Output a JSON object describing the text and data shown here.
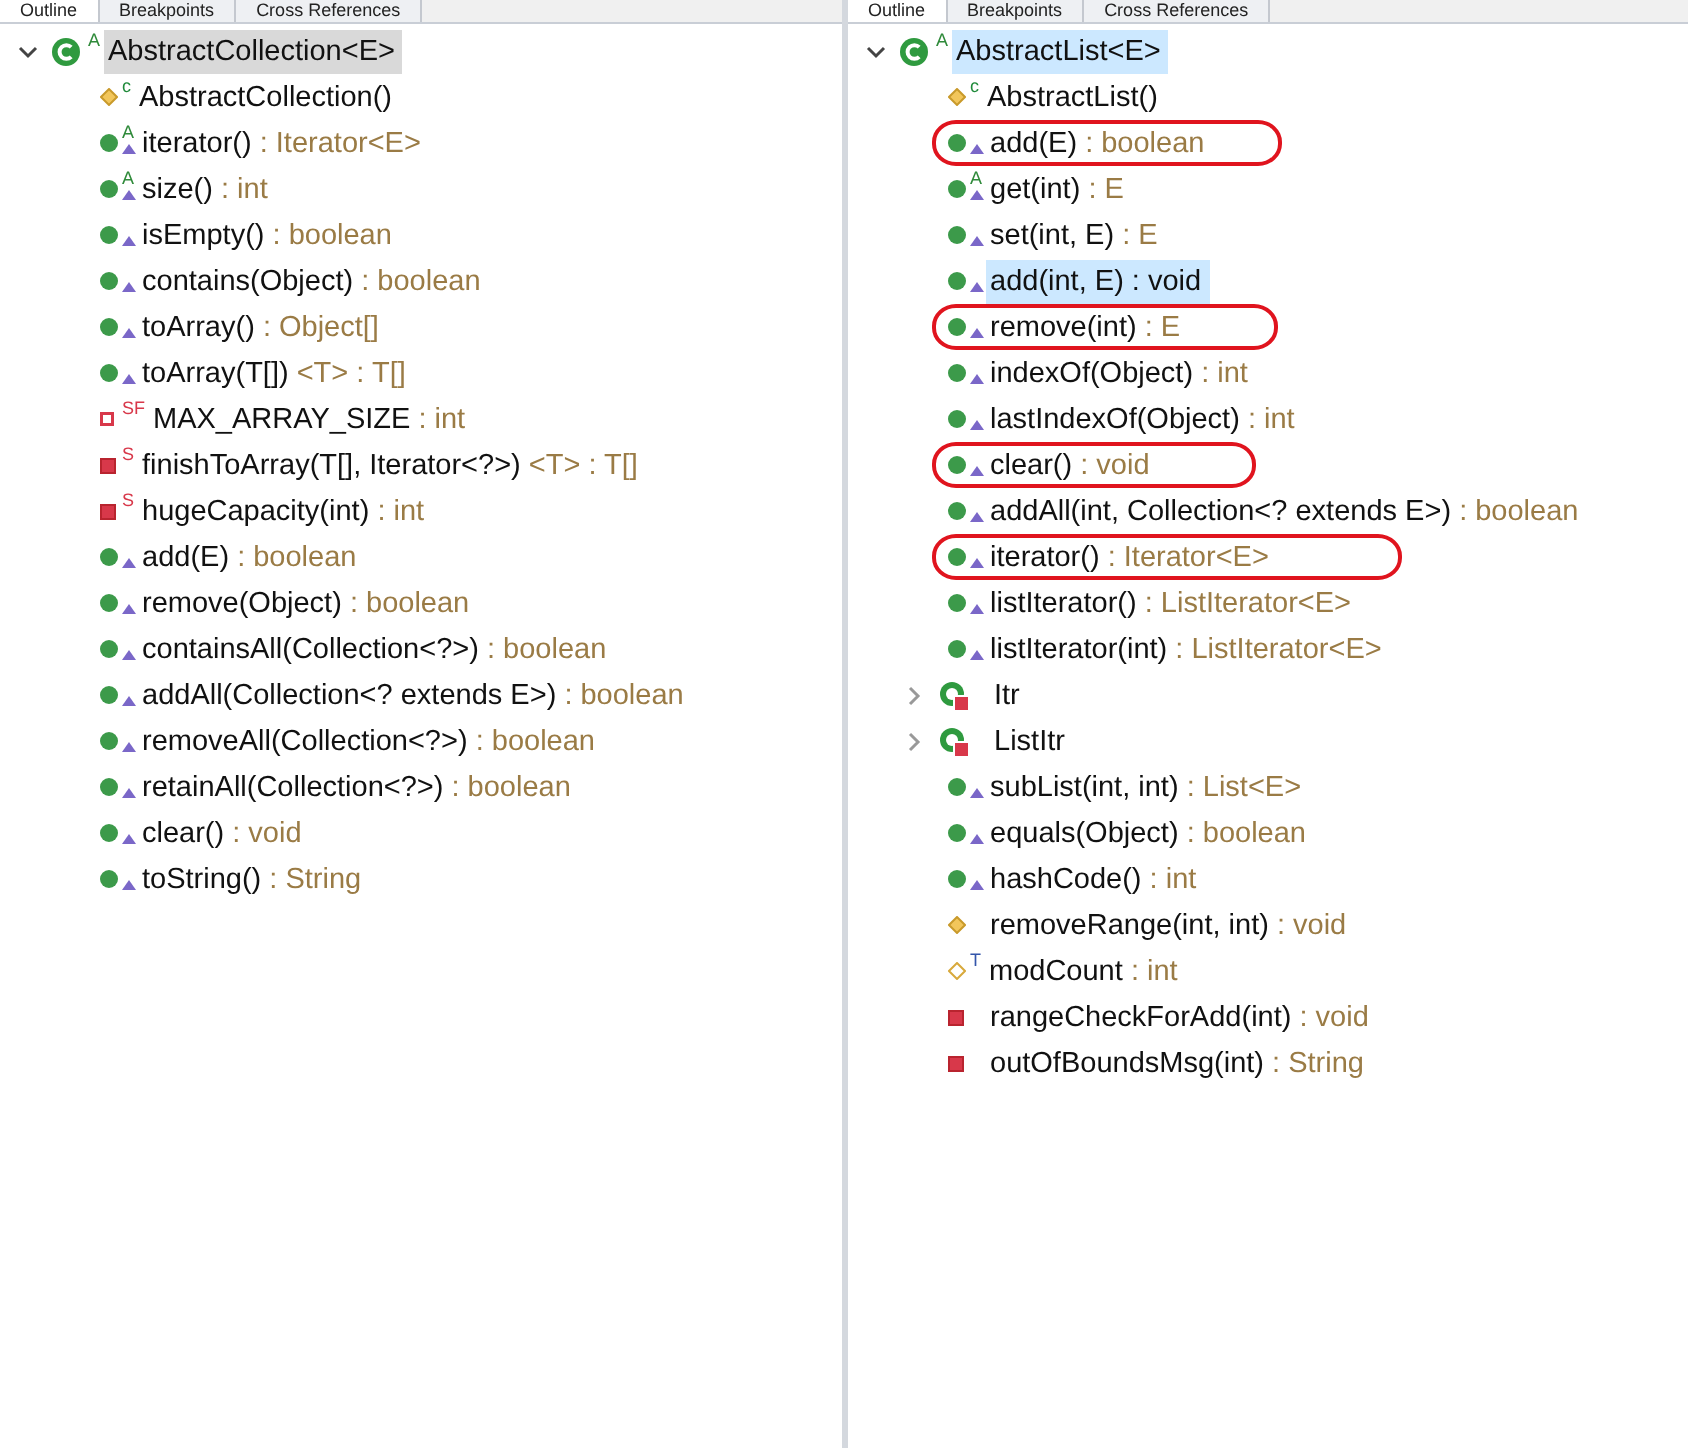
{
  "panes": [
    {
      "tabs": [
        {
          "label": "Outline",
          "selected": true
        },
        {
          "label": "Breakpoints",
          "selected": false
        },
        {
          "label": "Cross References",
          "selected": false
        }
      ],
      "tree": {
        "name": "AbstractCollection<E>",
        "kind": "class",
        "modifier": "A",
        "expanded": true,
        "selected": true,
        "focused": false,
        "children": [
          {
            "name": "AbstractCollection()",
            "kind": "protected",
            "modifier": "c",
            "overrides": false,
            "selected": false,
            "circled": false
          },
          {
            "name": "iterator()",
            "type": ": Iterator<E>",
            "kind": "public",
            "modifier": "A",
            "overrides": true,
            "selected": false,
            "circled": false
          },
          {
            "name": "size()",
            "type": ": int",
            "kind": "public",
            "modifier": "A",
            "overrides": true,
            "selected": false,
            "circled": false
          },
          {
            "name": "isEmpty()",
            "type": ": boolean",
            "kind": "public",
            "overrides": true,
            "selected": false,
            "circled": false
          },
          {
            "name": "contains(Object)",
            "type": ": boolean",
            "kind": "public",
            "overrides": true,
            "selected": false,
            "circled": false
          },
          {
            "name": "toArray()",
            "type": ": Object[]",
            "kind": "public",
            "overrides": true,
            "selected": false,
            "circled": false
          },
          {
            "name": "toArray(T[])",
            "type": "<T> : T[]",
            "kind": "public",
            "overrides": true,
            "selected": false,
            "circled": false
          },
          {
            "name": "MAX_ARRAY_SIZE",
            "type": ": int",
            "kind": "privatefield",
            "modifier": "SF",
            "overrides": false,
            "selected": false,
            "circled": false
          },
          {
            "name": "finishToArray(T[], Iterator<?>)",
            "type": "<T> : T[]",
            "kind": "private",
            "modifier": "S",
            "overrides": false,
            "selected": false,
            "circled": false
          },
          {
            "name": "hugeCapacity(int)",
            "type": ": int",
            "kind": "private",
            "modifier": "S",
            "overrides": false,
            "selected": false,
            "circled": false
          },
          {
            "name": "add(E)",
            "type": ": boolean",
            "kind": "public",
            "overrides": true,
            "selected": false,
            "circled": false
          },
          {
            "name": "remove(Object)",
            "type": ": boolean",
            "kind": "public",
            "overrides": true,
            "selected": false,
            "circled": false
          },
          {
            "name": "containsAll(Collection<?>)",
            "type": ": boolean",
            "kind": "public",
            "overrides": true,
            "selected": false,
            "circled": false
          },
          {
            "name": "addAll(Collection<? extends E>)",
            "type": ": boolean",
            "kind": "public",
            "overrides": true,
            "selected": false,
            "circled": false
          },
          {
            "name": "removeAll(Collection<?>)",
            "type": ": boolean",
            "kind": "public",
            "overrides": true,
            "selected": false,
            "circled": false
          },
          {
            "name": "retainAll(Collection<?>)",
            "type": ": boolean",
            "kind": "public",
            "overrides": true,
            "selected": false,
            "circled": false
          },
          {
            "name": "clear()",
            "type": ": void",
            "kind": "public",
            "overrides": true,
            "selected": false,
            "circled": false
          },
          {
            "name": "toString()",
            "type": ": String",
            "kind": "public",
            "overrides": true,
            "selected": false,
            "circled": false
          }
        ]
      }
    },
    {
      "tabs": [
        {
          "label": "Outline",
          "selected": true
        },
        {
          "label": "Breakpoints",
          "selected": false
        },
        {
          "label": "Cross References",
          "selected": false
        }
      ],
      "tree": {
        "name": "AbstractList<E>",
        "kind": "class",
        "modifier": "A",
        "expanded": true,
        "selected": true,
        "focused": true,
        "children": [
          {
            "name": "AbstractList()",
            "kind": "protected",
            "modifier": "c",
            "overrides": false,
            "selected": false,
            "circled": false
          },
          {
            "name": "add(E)",
            "type": ": boolean",
            "kind": "public",
            "overrides": true,
            "selected": false,
            "circled": true
          },
          {
            "name": "get(int)",
            "type": ": E",
            "kind": "public",
            "modifier": "A",
            "overrides": true,
            "selected": false,
            "circled": false
          },
          {
            "name": "set(int, E)",
            "type": ": E",
            "kind": "public",
            "overrides": true,
            "selected": false,
            "circled": false
          },
          {
            "name": "add(int, E) : void",
            "kind": "public",
            "overrides": true,
            "selected": true,
            "circled": false
          },
          {
            "name": "remove(int)",
            "type": ": E",
            "kind": "public",
            "overrides": true,
            "selected": false,
            "circled": true
          },
          {
            "name": "indexOf(Object)",
            "type": ": int",
            "kind": "public",
            "overrides": true,
            "selected": false,
            "circled": false
          },
          {
            "name": "lastIndexOf(Object)",
            "type": ": int",
            "kind": "public",
            "overrides": true,
            "selected": false,
            "circled": false
          },
          {
            "name": "clear()",
            "type": ": void",
            "kind": "public",
            "overrides": true,
            "selected": false,
            "circled": true
          },
          {
            "name": "addAll(int, Collection<? extends E>)",
            "type": ": boolean",
            "kind": "public",
            "overrides": true,
            "selected": false,
            "circled": false
          },
          {
            "name": "iterator()",
            "type": ": Iterator<E>",
            "kind": "public",
            "overrides": true,
            "selected": false,
            "circled": true
          },
          {
            "name": "listIterator()",
            "type": ": ListIterator<E>",
            "kind": "public",
            "overrides": true,
            "selected": false,
            "circled": false
          },
          {
            "name": "listIterator(int)",
            "type": ": ListIterator<E>",
            "kind": "public",
            "overrides": true,
            "selected": false,
            "circled": false
          },
          {
            "name": "Itr",
            "kind": "innerclass",
            "expanded": false,
            "overrides": false,
            "selected": false,
            "circled": false
          },
          {
            "name": "ListItr",
            "kind": "innerclass",
            "expanded": false,
            "overrides": false,
            "selected": false,
            "circled": false
          },
          {
            "name": "subList(int, int)",
            "type": ": List<E>",
            "kind": "public",
            "overrides": true,
            "selected": false,
            "circled": false
          },
          {
            "name": "equals(Object)",
            "type": ": boolean",
            "kind": "public",
            "overrides": true,
            "selected": false,
            "circled": false
          },
          {
            "name": "hashCode()",
            "type": ": int",
            "kind": "public",
            "overrides": true,
            "selected": false,
            "circled": false
          },
          {
            "name": "removeRange(int, int)",
            "type": ": void",
            "kind": "protected",
            "overrides": false,
            "selected": false,
            "circled": false
          },
          {
            "name": "modCount",
            "type": ": int",
            "kind": "protectedfield",
            "modifier": "T",
            "overrides": false,
            "selected": false,
            "circled": false
          },
          {
            "name": "rangeCheckForAdd(int)",
            "type": ": void",
            "kind": "private",
            "overrides": false,
            "selected": false,
            "circled": false
          },
          {
            "name": "outOfBoundsMsg(int)",
            "type": ": String",
            "kind": "private",
            "overrides": false,
            "selected": false,
            "circled": false
          }
        ]
      }
    }
  ]
}
